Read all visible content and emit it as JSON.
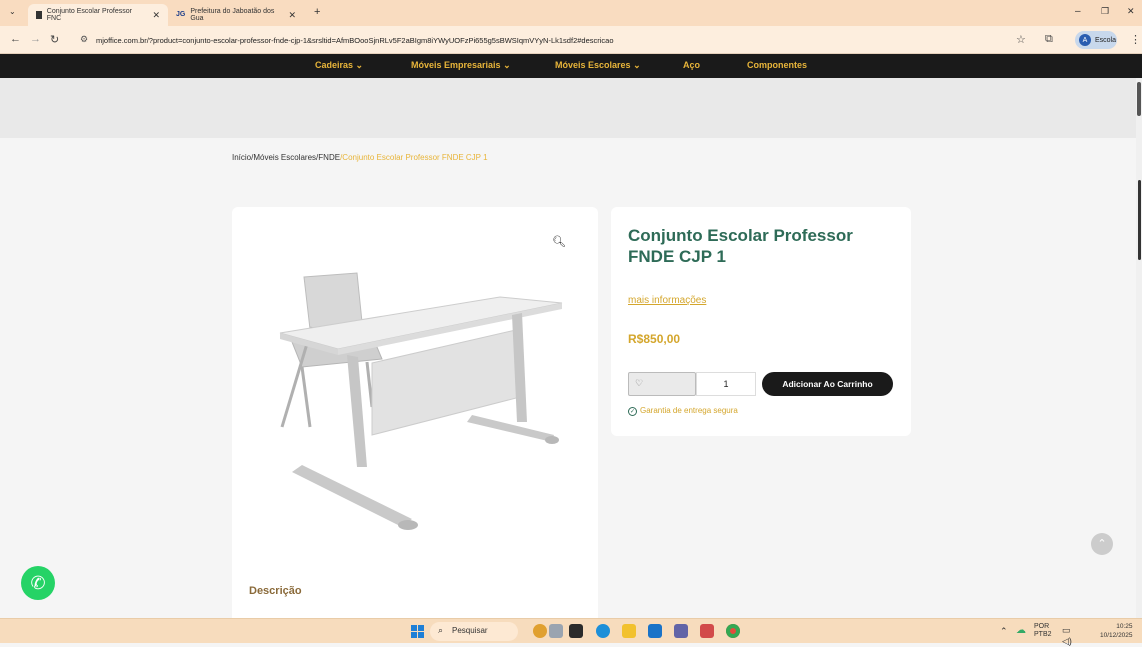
{
  "browser": {
    "tabs": [
      {
        "title": "Conjunto Escolar Professor FNC",
        "active": true
      },
      {
        "title": "Prefeitura do Jaboatão dos Gua",
        "active": false
      }
    ],
    "url": "mjoffice.com.br/?product=conjunto-escolar-professor-fnde-cjp-1&srsltid=AfmBOooSjnRLv5F2aBIgm8iYWyUOFzPi655g5sBWSIqmVYyN-Lk1sdf2#descricao",
    "profile_label": "Escola",
    "profile_initial": "A"
  },
  "site_nav": {
    "items": [
      {
        "label": "Cadeiras",
        "has_dropdown": true
      },
      {
        "label": "Móveis Empresariais",
        "has_dropdown": true
      },
      {
        "label": "Móveis Escolares",
        "has_dropdown": true
      },
      {
        "label": "Aço",
        "has_dropdown": false
      },
      {
        "label": "Componentes",
        "has_dropdown": false
      }
    ]
  },
  "breadcrumb": {
    "home": "Início",
    "cat1": "Móveis Escolares",
    "cat2": "FNDE",
    "current": "Conjunto Escolar Professor FNDE CJP 1"
  },
  "product": {
    "title": "Conjunto Escolar Professor FNDE CJP 1",
    "more_info": "mais informações",
    "price": "R$850,00",
    "quantity": "1",
    "add_to_cart": "Adicionar Ao Carrinho",
    "guarantee": "Garantia de entrega segura",
    "description_label": "Descrição"
  },
  "taskbar": {
    "search_placeholder": "Pesquisar",
    "lang_top": "POR",
    "lang_bottom": "PTB2",
    "time": "10:25",
    "date": "10/12/2025"
  },
  "colors": {
    "accent_gold": "#e8b53a",
    "title_green": "#2e6b57",
    "nav_bg": "#1a1a1a"
  }
}
